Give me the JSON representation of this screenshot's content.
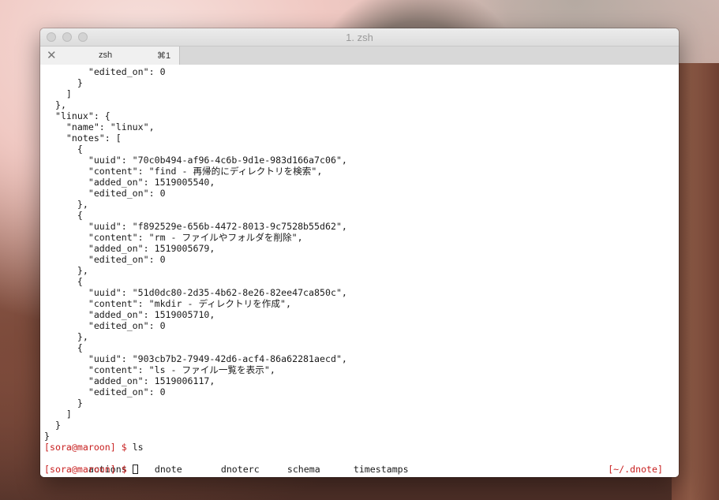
{
  "window": {
    "title": "1. zsh"
  },
  "tab": {
    "close_glyph": "✕",
    "label": "zsh",
    "shortcut": "⌘1"
  },
  "output_lines": [
    "        \"edited_on\": 0",
    "      }",
    "    ]",
    "  },",
    "  \"linux\": {",
    "    \"name\": \"linux\",",
    "    \"notes\": [",
    "      {",
    "        \"uuid\": \"70c0b494-af96-4c6b-9d1e-983d166a7c06\",",
    "        \"content\": \"find - 再帰的にディレクトリを検索\",",
    "        \"added_on\": 1519005540,",
    "        \"edited_on\": 0",
    "      },",
    "      {",
    "        \"uuid\": \"f892529e-656b-4472-8013-9c7528b55d62\",",
    "        \"content\": \"rm - ファイルやフォルダを削除\",",
    "        \"added_on\": 1519005679,",
    "        \"edited_on\": 0",
    "      },",
    "      {",
    "        \"uuid\": \"51d0dc80-2d35-4b62-8e26-82ee47ca850c\",",
    "        \"content\": \"mkdir - ディレクトリを作成\",",
    "        \"added_on\": 1519005710,",
    "        \"edited_on\": 0",
    "      },",
    "      {",
    "        \"uuid\": \"903cb7b2-7949-42d6-acf4-86a62281aecd\",",
    "        \"content\": \"ls - ファイル一覧を表示\",",
    "        \"added_on\": 1519006117,",
    "        \"edited_on\": 0",
    "      }",
    "    ]",
    "  }",
    "}"
  ],
  "prompt1": {
    "prompt": "[sora@maroon] $ ",
    "command": "ls"
  },
  "ls_output": [
    "actions",
    "dnote",
    "dnoterc",
    "schema",
    "timestamps"
  ],
  "prompt2": {
    "prompt": "[sora@maroon] $ ",
    "rprompt": "[~/.dnote]"
  },
  "colors": {
    "prompt": "#c82020",
    "text": "#1a1a1a",
    "background": "#ffffff"
  }
}
